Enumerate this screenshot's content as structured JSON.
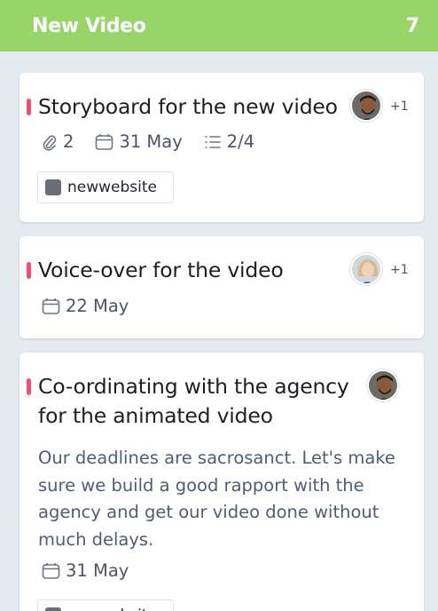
{
  "column": {
    "title": "New Video",
    "count": "7",
    "color": "#97d56a"
  },
  "colors": {
    "priority": "#f0506e",
    "tag": "#6a6e79",
    "background": "#e5e9f0"
  },
  "cards": [
    {
      "title": "Storyboard for the new video",
      "extra_assignees": "+1",
      "attachments": "2",
      "due_date": "31 May",
      "checklist": "2/4",
      "tag": "newwebsite",
      "icons": [
        "paperclip-icon",
        "calendar-icon",
        "checklist-icon"
      ]
    },
    {
      "title": "Voice-over for the video",
      "extra_assignees": "+1",
      "due_date": "22 May",
      "icons": [
        "calendar-icon"
      ]
    },
    {
      "title_line1": "Co-ordinating with the agency",
      "title_line2": "for the animated video",
      "description_lines": [
        "Our deadlines are sacrosanct. Let's make",
        "sure we build a good rapport with the",
        "agency and get our video done without",
        "much delays."
      ],
      "due_date": "31 May",
      "icons": [
        "calendar-icon"
      ]
    }
  ]
}
